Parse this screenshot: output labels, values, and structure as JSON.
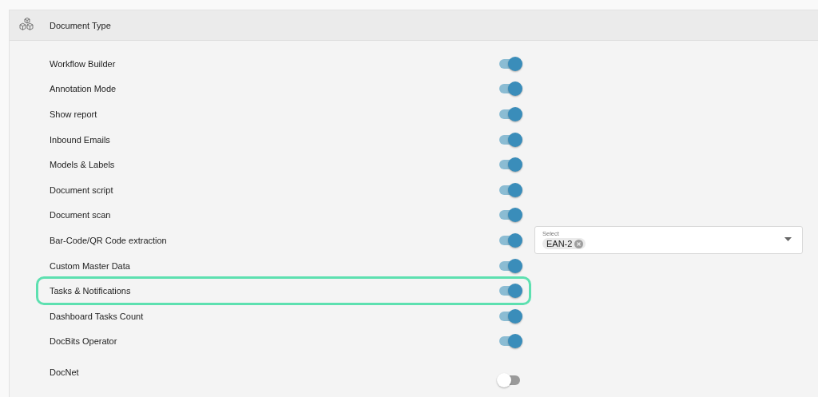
{
  "section": {
    "title": "Document Type"
  },
  "rows": [
    {
      "kind": "inline",
      "label": "Workflow Builder",
      "on": true,
      "highlighted": false
    },
    {
      "kind": "inline",
      "label": "Annotation Mode",
      "on": true,
      "highlighted": false
    },
    {
      "kind": "inline",
      "label": "Show report",
      "on": true,
      "highlighted": false
    },
    {
      "kind": "inline",
      "label": "Inbound Emails",
      "on": true,
      "highlighted": false
    },
    {
      "kind": "inline",
      "label": "Models & Labels",
      "on": true,
      "highlighted": false
    },
    {
      "kind": "inline",
      "label": "Document script",
      "on": true,
      "highlighted": false
    },
    {
      "kind": "inline",
      "label": "Document scan",
      "on": true,
      "highlighted": false
    },
    {
      "kind": "inline",
      "label": "Bar-Code/QR Code extraction",
      "on": true,
      "highlighted": false,
      "select": {
        "label": "Select",
        "chips": [
          "EAN-2"
        ]
      }
    },
    {
      "kind": "inline",
      "label": "Custom Master Data",
      "on": true,
      "highlighted": false
    },
    {
      "kind": "inline",
      "label": "Tasks & Notifications",
      "on": true,
      "highlighted": true
    },
    {
      "kind": "inline",
      "label": "Dashboard Tasks Count",
      "on": true,
      "highlighted": false
    },
    {
      "kind": "inline",
      "label": "DocBits Operator",
      "on": true,
      "highlighted": false
    },
    {
      "kind": "stacked",
      "label": "DocNet",
      "on": false,
      "highlighted": false
    }
  ]
}
